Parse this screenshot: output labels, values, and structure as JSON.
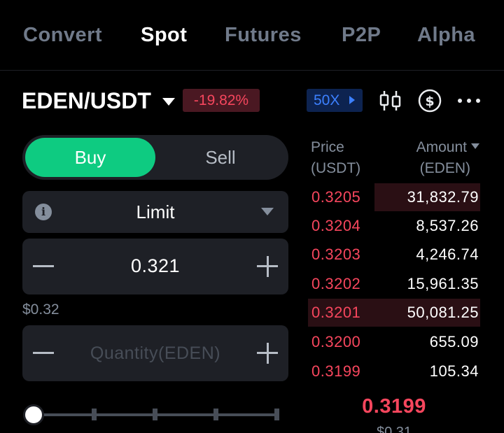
{
  "tabs": [
    {
      "label": "Convert"
    },
    {
      "label": "Spot"
    },
    {
      "label": "Futures"
    },
    {
      "label": "P2P"
    },
    {
      "label": "Alpha"
    }
  ],
  "active_tab": "Spot",
  "header": {
    "pair": "EDEN/USDT",
    "change": "-19.82%",
    "leverage": "50X",
    "icons": [
      "candlestick-chart-icon",
      "dollar-circle-icon",
      "more-icon"
    ]
  },
  "trade": {
    "buy_label": "Buy",
    "sell_label": "Sell",
    "order_type": "Limit",
    "price_value": "0.321",
    "usd_estimate": "$0.32",
    "quantity_placeholder": "Quantity(EDEN)",
    "slider_value": 0
  },
  "order_book": {
    "price_header_1": "Price",
    "price_header_2": "(USDT)",
    "amount_header_1": "Amount",
    "amount_header_2": "(EDEN)",
    "asks": [
      {
        "price": "0.3205",
        "amount": "31,832.79"
      },
      {
        "price": "0.3204",
        "amount": "8,537.26"
      },
      {
        "price": "0.3203",
        "amount": "4,246.74"
      },
      {
        "price": "0.3202",
        "amount": "15,961.35"
      },
      {
        "price": "0.3201",
        "amount": "50,081.25"
      },
      {
        "price": "0.3200",
        "amount": "655.09"
      },
      {
        "price": "0.3199",
        "amount": "105.34"
      }
    ],
    "last_price": "0.3199",
    "last_price_usd": "$0.31"
  },
  "colors": {
    "buy": "#0ecb81",
    "sell": "#f6465d",
    "accent_blue": "#3c80ff",
    "background": "#000000"
  }
}
